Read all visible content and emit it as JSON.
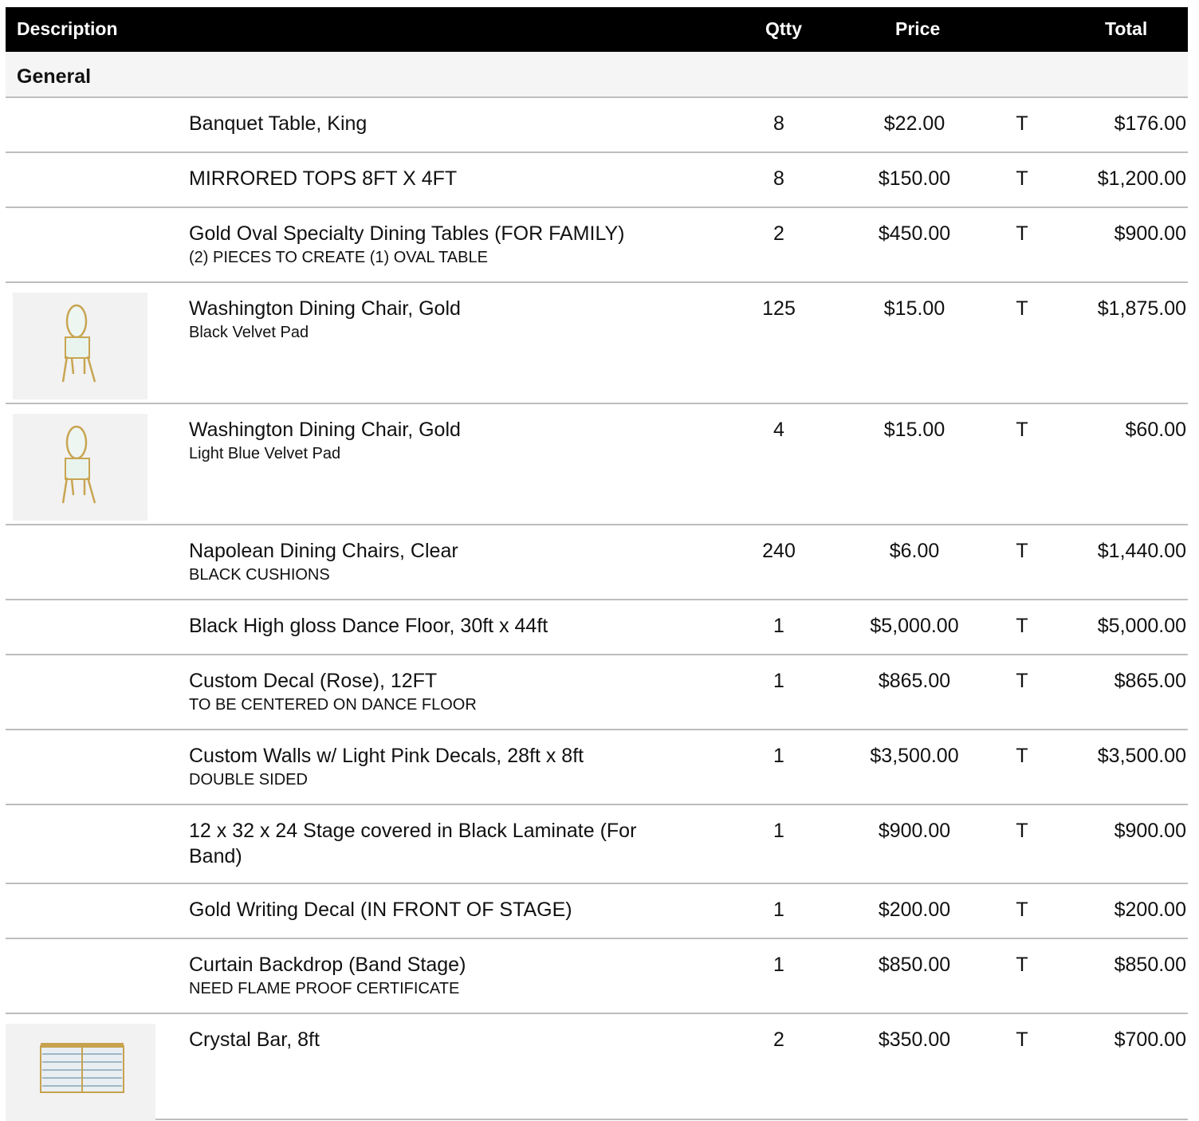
{
  "header": {
    "description": "Description",
    "qty": "Qtty",
    "price": "Price",
    "total": "Total"
  },
  "section": {
    "name": "General"
  },
  "rows": [
    {
      "title": "Banquet Table, King",
      "note": "",
      "qty": "8",
      "price": "$22.00",
      "tax": "T",
      "total": "$176.00",
      "image": ""
    },
    {
      "title": "MIRRORED TOPS 8FT X 4FT",
      "note": "",
      "qty": "8",
      "price": "$150.00",
      "tax": "T",
      "total": "$1,200.00",
      "image": ""
    },
    {
      "title": "Gold Oval Specialty Dining Tables (FOR FAMILY)",
      "note": "(2) PIECES TO CREATE (1)  OVAL TABLE",
      "qty": "2",
      "price": "$450.00",
      "tax": "T",
      "total": "$900.00",
      "image": ""
    },
    {
      "title": "Washington Dining Chair, Gold",
      "note": "Black Velvet Pad",
      "qty": "125",
      "price": "$15.00",
      "tax": "T",
      "total": "$1,875.00",
      "image": "chair-image"
    },
    {
      "title": "Washington Dining Chair, Gold",
      "note": "Light Blue Velvet Pad",
      "qty": "4",
      "price": "$15.00",
      "tax": "T",
      "total": "$60.00",
      "image": "chair-image"
    },
    {
      "title": "Napolean Dining Chairs, Clear",
      "note": "BLACK  CUSHIONS",
      "qty": "240",
      "price": "$6.00",
      "tax": "T",
      "total": "$1,440.00",
      "image": ""
    },
    {
      "title": "Black High gloss Dance Floor, 30ft x 44ft",
      "note": "",
      "qty": "1",
      "price": "$5,000.00",
      "tax": "T",
      "total": "$5,000.00",
      "image": ""
    },
    {
      "title": "Custom Decal (Rose), 12FT",
      "note": "TO BE CENTERED ON DANCE FLOOR",
      "qty": "1",
      "price": "$865.00",
      "tax": "T",
      "total": "$865.00",
      "image": ""
    },
    {
      "title": "Custom Walls w/ Light Pink Decals, 28ft x 8ft",
      "note": "DOUBLE SIDED",
      "qty": "1",
      "price": "$3,500.00",
      "tax": "T",
      "total": "$3,500.00",
      "image": ""
    },
    {
      "title": "12 x 32 x 24 Stage covered in Black Laminate  (For Band)",
      "note": "",
      "qty": "1",
      "price": "$900.00",
      "tax": "T",
      "total": "$900.00",
      "image": ""
    },
    {
      "title": "Gold Writing Decal (IN FRONT OF STAGE)",
      "note": "",
      "qty": "1",
      "price": "$200.00",
      "tax": "T",
      "total": "$200.00",
      "image": ""
    },
    {
      "title": "Curtain Backdrop (Band Stage)",
      "note": "NEED FLAME PROOF CERTIFICATE",
      "qty": "1",
      "price": "$850.00",
      "tax": "T",
      "total": "$850.00",
      "image": ""
    },
    {
      "title": "Crystal Bar, 8ft",
      "note": "",
      "qty": "2",
      "price": "$350.00",
      "tax": "T",
      "total": "$700.00",
      "image": "bar-image"
    }
  ]
}
